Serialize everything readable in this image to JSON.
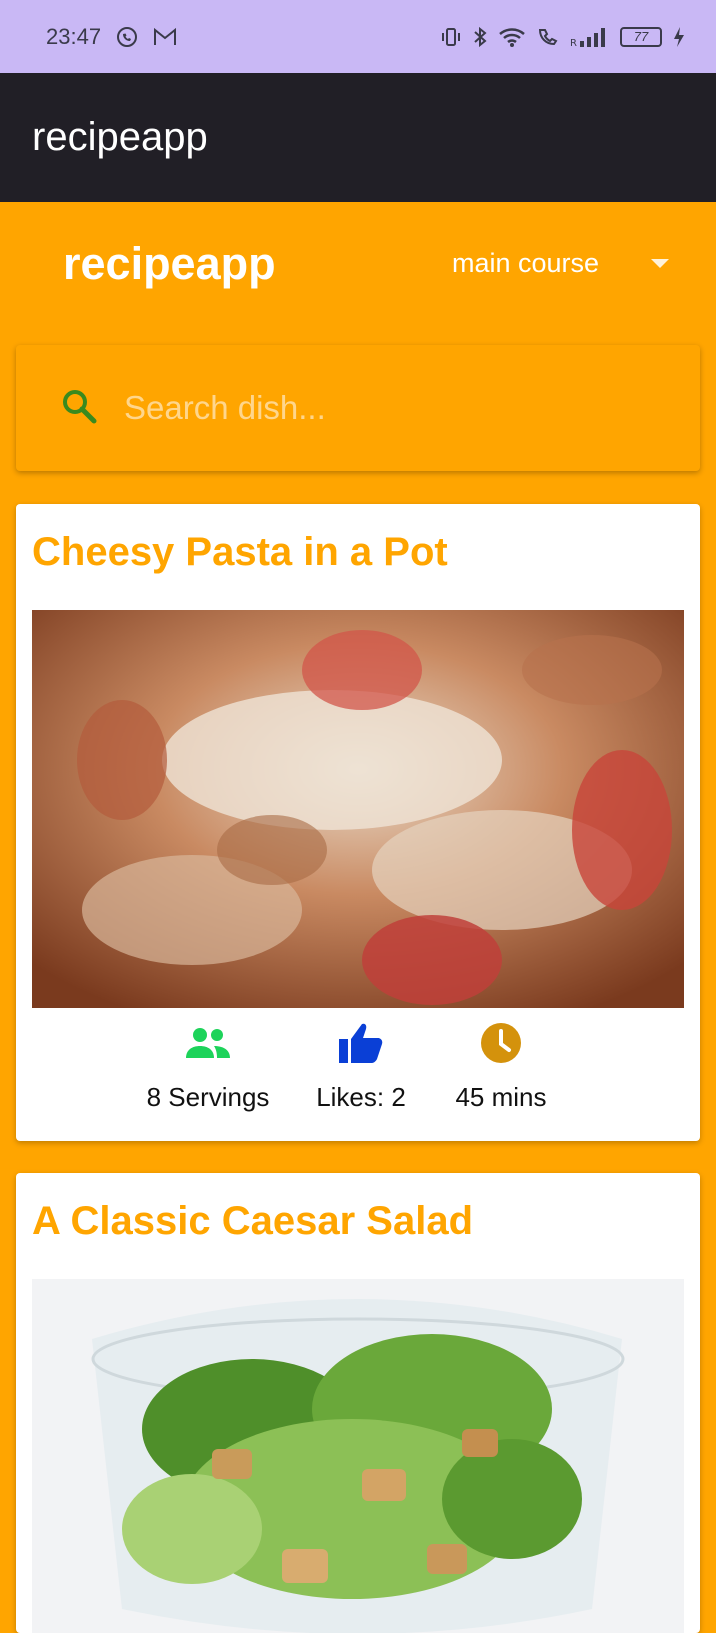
{
  "status_bar": {
    "time": "23:47",
    "battery": "77",
    "icons": [
      "whatsapp-icon",
      "gmail-icon",
      "vibrate-icon",
      "bluetooth-icon",
      "wifi-icon",
      "wifi-call-icon",
      "signal-icon",
      "battery-icon",
      "charging-icon"
    ]
  },
  "app_bar": {
    "title": "recipeapp"
  },
  "header": {
    "brand": "recipeapp",
    "category": "main course"
  },
  "search": {
    "placeholder": "Search dish..."
  },
  "recipes": [
    {
      "title": "Cheesy Pasta in a Pot",
      "servings": "8 Servings",
      "likes": "Likes: 2",
      "time": "45 mins"
    },
    {
      "title": "A Classic Caesar Salad"
    }
  ],
  "colors": {
    "accent": "#FFA500",
    "app_bar": "#211F26",
    "status_bar": "#C9B8F5",
    "servings_icon": "#1DD35A",
    "likes_icon": "#0A3FD6",
    "time_icon": "#D4920C",
    "search_icon": "#3A8A1E"
  }
}
